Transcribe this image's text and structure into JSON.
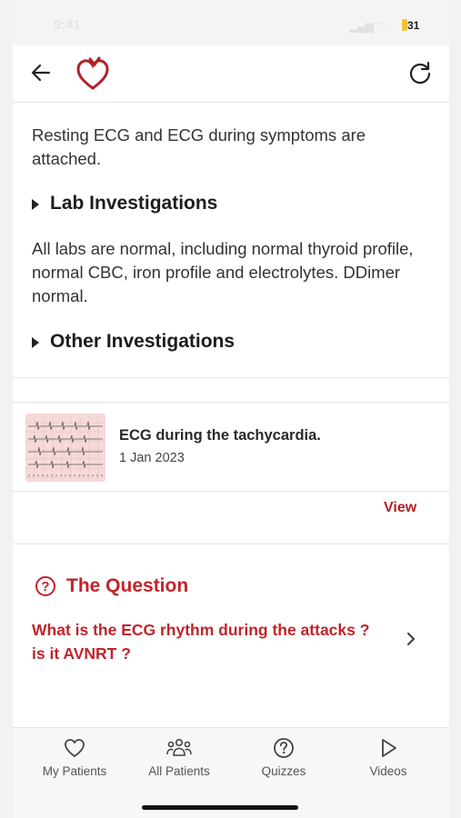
{
  "status": {
    "time": "9:41",
    "signal": "",
    "battery": "31"
  },
  "header": {
    "back": "back",
    "logo": "heart-logo",
    "refresh": "refresh"
  },
  "content": {
    "intro_text": "Resting ECG and ECG during symptoms are attached.",
    "lab_heading": "Lab Investigations",
    "lab_text": "All labs are normal, including normal thyroid profile, normal CBC, iron profile and electrolytes. DDimer normal.",
    "other_heading": "Other Investigations"
  },
  "attachment": {
    "title": "ECG during the tachycardia.",
    "date": "1 Jan 2023",
    "view_label": "View"
  },
  "question": {
    "heading": "The Question",
    "text": "What is the ECG rhythm during the attacks ? is it AVNRT ?"
  },
  "tabs": [
    {
      "label": "My Patients",
      "icon": "heart-icon"
    },
    {
      "label": "All Patients",
      "icon": "people-icon"
    },
    {
      "label": "Quizzes",
      "icon": "question-icon"
    },
    {
      "label": "Videos",
      "icon": "play-icon"
    }
  ],
  "colors": {
    "accent": "#c0252b",
    "text": "#333333",
    "background": "#ffffff"
  }
}
